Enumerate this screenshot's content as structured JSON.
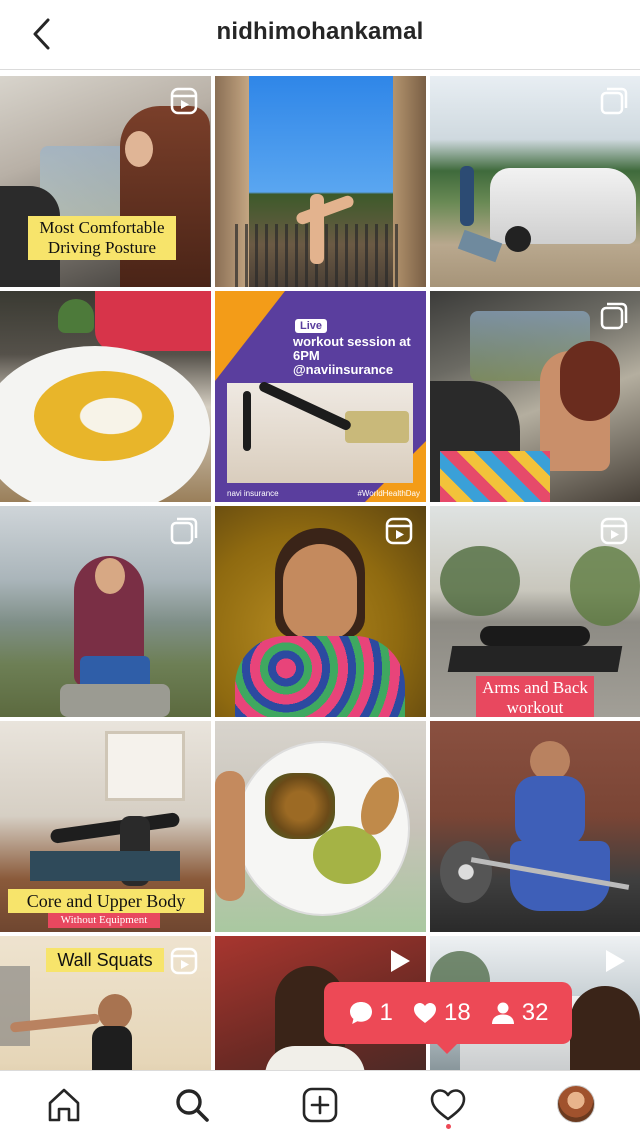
{
  "header": {
    "title": "nidhimohankamal"
  },
  "posts": [
    {
      "type": "reel",
      "caption": "Most Comfortable Driving Posture"
    },
    {
      "type": "none",
      "caption": ""
    },
    {
      "type": "carousel",
      "caption": ""
    },
    {
      "type": "none",
      "caption": ""
    },
    {
      "type": "none",
      "caption": "",
      "live_label": "Live",
      "promo_text": "workout session at 6PM @naviinsurance",
      "brand": "navi insurance",
      "hashtag": "#WorldHealthDay"
    },
    {
      "type": "carousel",
      "caption": ""
    },
    {
      "type": "carousel",
      "caption": ""
    },
    {
      "type": "reel",
      "caption": ""
    },
    {
      "type": "reel",
      "caption": "Arms and Back workout"
    },
    {
      "type": "none",
      "caption": "Core and Upper Body",
      "subcaption": "Without Equipment"
    },
    {
      "type": "none",
      "caption": ""
    },
    {
      "type": "none",
      "caption": ""
    },
    {
      "type": "reel",
      "caption": "Wall Squats"
    },
    {
      "type": "video",
      "caption": ""
    },
    {
      "type": "video",
      "caption": ""
    }
  ],
  "notification": {
    "comments": "1",
    "likes": "18",
    "followers": "32"
  },
  "tabbar": {
    "items": [
      "home",
      "search",
      "new-post",
      "activity",
      "profile"
    ]
  }
}
